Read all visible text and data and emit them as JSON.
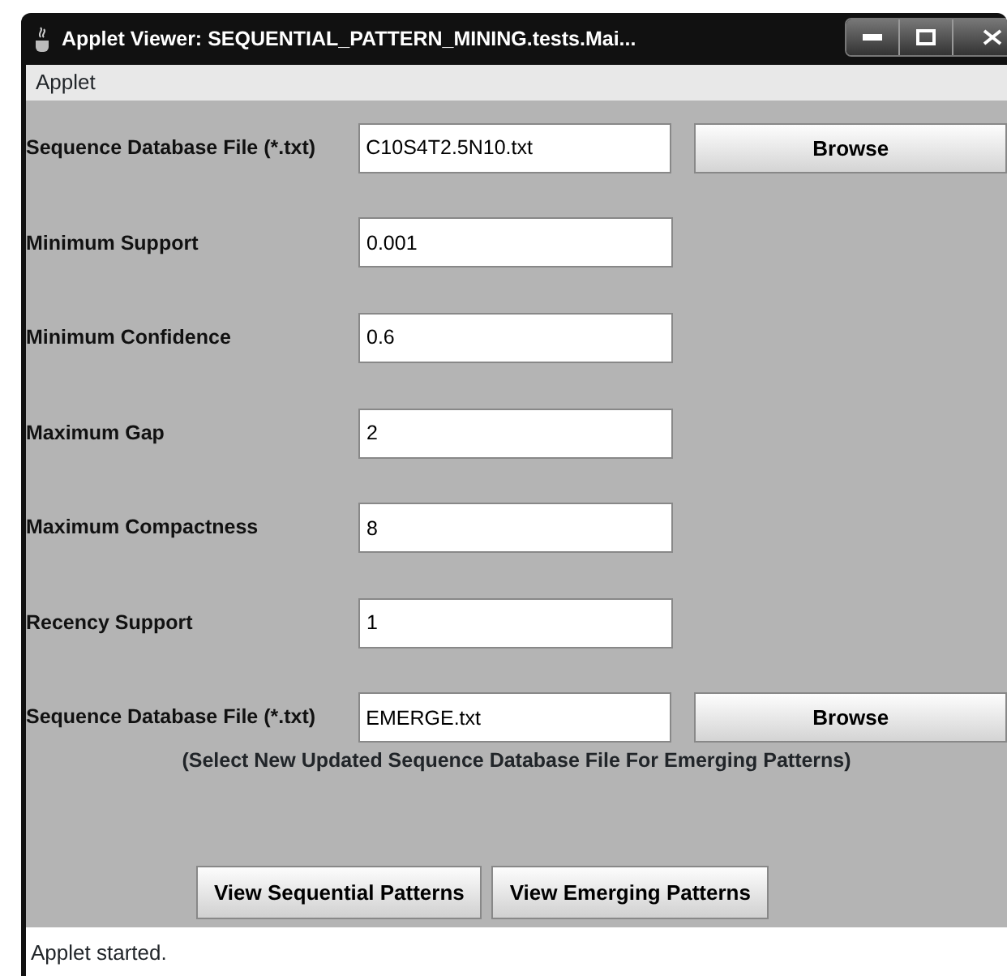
{
  "window": {
    "title": "Applet Viewer: SEQUENTIAL_PATTERN_MINING.tests.Mai..."
  },
  "menu": [
    "Applet"
  ],
  "fields": [
    {
      "kind": "file",
      "label": "Sequence Database File (*.txt)",
      "value": "C10S4T2.5N10.txt",
      "button": "Browse"
    },
    {
      "kind": "text",
      "label": "Minimum Support",
      "value": "0.001"
    },
    {
      "kind": "text",
      "label": "Minimum Confidence",
      "value": "0.6"
    },
    {
      "kind": "text",
      "label": "Maximum Gap",
      "value": "2"
    },
    {
      "kind": "text",
      "label": "Maximum Compactness",
      "value": "8"
    },
    {
      "kind": "text",
      "label": "Recency Support",
      "value": "1"
    },
    {
      "kind": "file",
      "label": "Sequence Database File (*.txt)",
      "value": "EMERGE.txt",
      "button": "Browse"
    }
  ],
  "note": "(Select New Updated Sequence Database File For Emerging Patterns)",
  "buttons": [
    "View Sequential Patterns",
    "View Emerging Patterns"
  ],
  "status_bar": "Applet started."
}
